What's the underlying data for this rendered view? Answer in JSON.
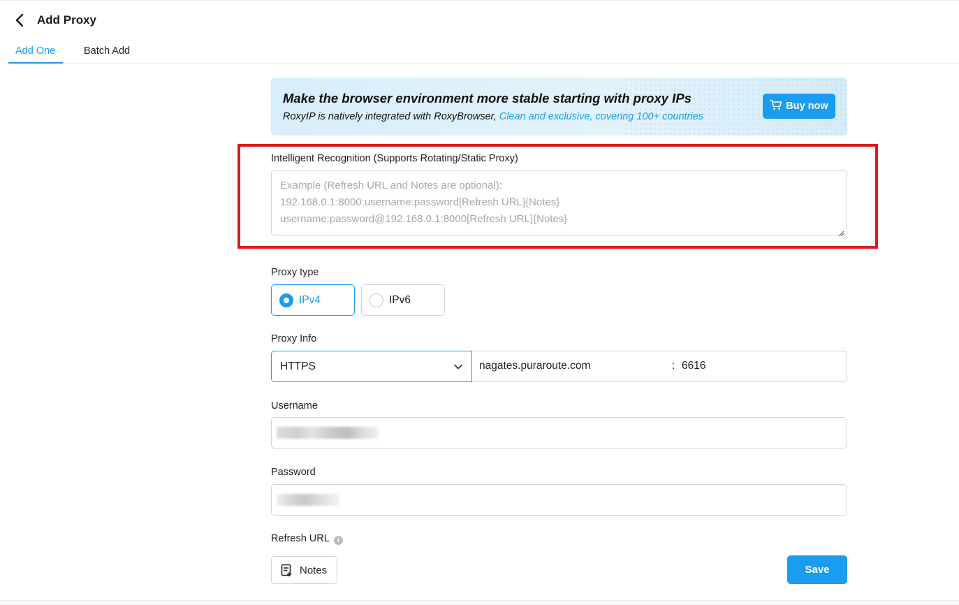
{
  "header": {
    "title": "Add Proxy"
  },
  "tabs": [
    {
      "label": "Add One",
      "active": true
    },
    {
      "label": "Batch Add",
      "active": false
    }
  ],
  "banner": {
    "title": "Make the browser environment more stable starting with proxy IPs",
    "subtitle": "RoxyIP is natively integrated with RoxyBrowser,",
    "subtitle_highlight": "Clean and exclusive, covering 100+ countries",
    "buy_label": "Buy now"
  },
  "recognition": {
    "label": "Intelligent Recognition (Supports Rotating/Static Proxy)",
    "placeholder_line1": "Example (Refresh URL and Notes are optional):",
    "placeholder_line2": "192.168.0.1:8000:username:password[Refresh URL]{Notes}",
    "placeholder_line3": "username:password@192.168.0.1:8000[Refresh URL]{Notes}"
  },
  "proxy_type": {
    "label": "Proxy type",
    "options": [
      {
        "label": "IPv4",
        "selected": true
      },
      {
        "label": "IPv6",
        "selected": false
      }
    ]
  },
  "proxy_info": {
    "label": "Proxy Info",
    "protocol": "HTTPS",
    "host": "nagates.puraroute.com",
    "separator": ":",
    "port": "6616"
  },
  "username": {
    "label": "Username"
  },
  "password": {
    "label": "Password"
  },
  "refresh_url": {
    "label": "Refresh URL"
  },
  "actions": {
    "notes_label": "Notes",
    "save_label": "Save"
  },
  "colors": {
    "accent": "#1a9cf0",
    "highlight_border": "#e0181c",
    "border": "#d0d4da"
  }
}
